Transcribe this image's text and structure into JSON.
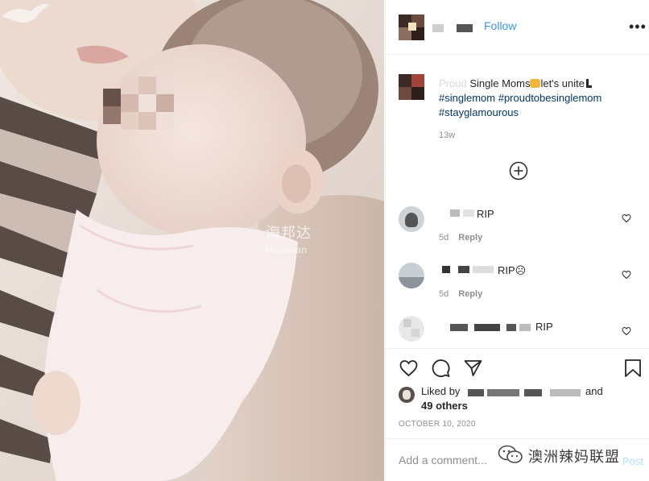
{
  "post": {
    "follow_label": "Follow",
    "more_label": "•••",
    "caption_prefix": "Proud",
    "caption_text": " Single Moms",
    "caption_mid": "let's unite",
    "hashtags": [
      "#singlemom",
      "#proudtobesinglemom",
      "#stayglamourous"
    ],
    "caption_time": "13w"
  },
  "watermark": {
    "cn": "海邦达",
    "en": "Hinabian"
  },
  "comments": [
    {
      "text": "RIP",
      "time": "5d",
      "reply": "Reply"
    },
    {
      "text": "RIP☹",
      "time": "5d",
      "reply": "Reply"
    },
    {
      "text": "RIP"
    }
  ],
  "likes": {
    "liked_by": "Liked by",
    "and": "and",
    "others": "49 others"
  },
  "date": "OCTOBER 10, 2020",
  "add_comment": {
    "placeholder": "Add a comment...",
    "post_label": "Post"
  },
  "wechat_label": "澳洲辣妈联盟",
  "colors": {
    "follow_blue": "#3897f0",
    "hashtag": "#00376b",
    "meta_gray": "#8e8e8e"
  }
}
